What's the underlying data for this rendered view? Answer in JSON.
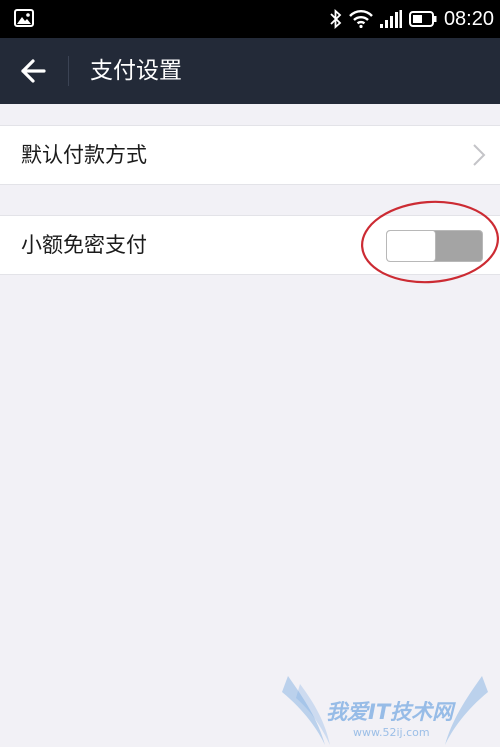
{
  "status_bar": {
    "time": "08:20",
    "icons": [
      "gallery-icon",
      "bluetooth-icon",
      "wifi-icon",
      "signal-icon",
      "battery-icon"
    ]
  },
  "header": {
    "title": "支付设置",
    "back_icon": "back-arrow-icon"
  },
  "settings": [
    {
      "label": "默认付款方式",
      "control": "chevron"
    },
    {
      "label": "小额免密支付",
      "control": "toggle",
      "enabled": false
    }
  ],
  "annotation": {
    "shape": "circle",
    "color": "#cc2b33",
    "target": "toggle"
  },
  "watermark": {
    "text": "我爱IT技术网",
    "url": "www.52ij.com",
    "color": "#78aae1"
  },
  "colors": {
    "nav_background": "#232a38",
    "page_background": "#f2f1f6",
    "toggle_off": "#a4a4a4"
  }
}
